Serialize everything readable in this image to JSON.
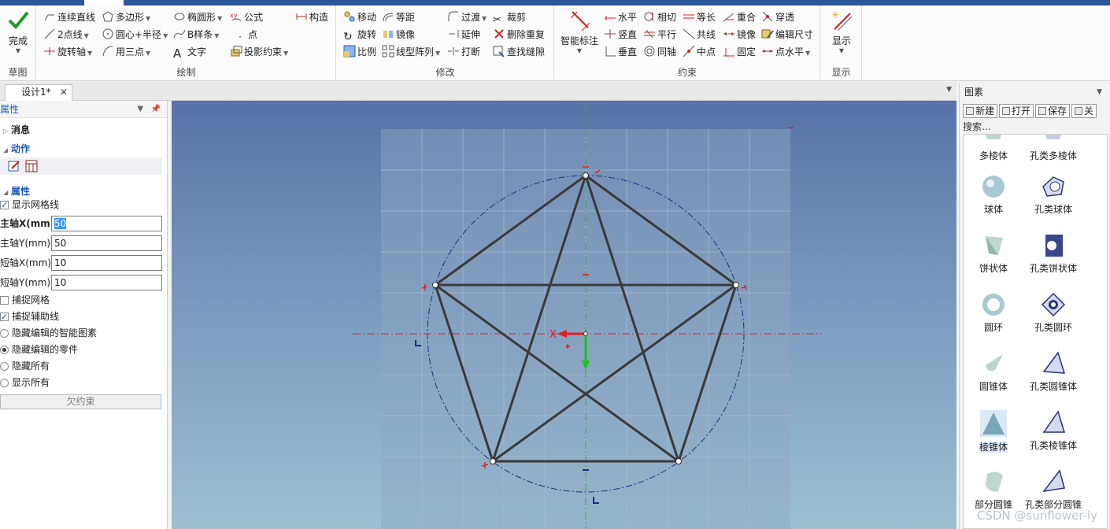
{
  "ribbon": {
    "groups": [
      {
        "label": "草图"
      },
      {
        "label": "绘制"
      },
      {
        "label": "修改"
      },
      {
        "label": "约束"
      },
      {
        "label": "显示"
      }
    ],
    "sketch": {
      "finish": "完成"
    },
    "draw": {
      "items": [
        "连续直线",
        "多边形",
        "椭圆形",
        "公式",
        "构造",
        "2点线",
        "圆心+半径",
        "B样条",
        "点",
        "旋转轴",
        "用三点",
        "文字",
        "投影约束"
      ]
    },
    "modify": {
      "items": [
        "移动",
        "等距",
        "过渡",
        "裁剪",
        "旋转",
        "镜像",
        "延伸",
        "删除重复",
        "比例",
        "线型阵列",
        "打断",
        "查找缝隙"
      ]
    },
    "constrain": {
      "smart": "智能标注",
      "items": [
        "水平",
        "相切",
        "等长",
        "重合",
        "穿透",
        "竖直",
        "平行",
        "共线",
        "镜像",
        "编辑尺寸",
        "垂直",
        "同轴",
        "中点",
        "固定",
        "点水平"
      ]
    },
    "display": {
      "label": "显示"
    }
  },
  "tabs": {
    "document": "设计1*",
    "close": "✕"
  },
  "properties": {
    "header": "属性",
    "sections": {
      "message": "消息",
      "action": "动作",
      "attributes": "属性"
    },
    "show_grid": {
      "label": "显示网格线",
      "checked": true
    },
    "fields": [
      {
        "label": "主轴X(mm)",
        "value": "50"
      },
      {
        "label": "主轴Y(mm)",
        "value": "50"
      },
      {
        "label": "短轴X(mm)",
        "value": "10"
      },
      {
        "label": "短轴Y(mm)",
        "value": "10"
      }
    ],
    "snap_grid": {
      "label": "捕捉网格",
      "checked": false
    },
    "snap_guides": {
      "label": "捕捉辅助线",
      "checked": true
    },
    "radios": [
      {
        "label": "隐藏编辑的智能图素",
        "selected": false
      },
      {
        "label": "隐藏编辑的零件",
        "selected": true
      },
      {
        "label": "隐藏所有",
        "selected": false
      },
      {
        "label": "显示所有",
        "selected": false
      }
    ],
    "status_button": "欠约束"
  },
  "canvas": {
    "axis_label": "X",
    "colors": {
      "axis_x": "#e02020",
      "axis_y": "#20c020",
      "sketch_line": "#3a3a3a",
      "circle": "#1a2f80",
      "bg_top": "#5872a8",
      "bg_bottom": "#9cc0d0"
    },
    "sketch": {
      "shape": "pentagon with inscribed pentagram",
      "circle_radius_mm": 50,
      "vertex_count": 5
    }
  },
  "catalog": {
    "header": "图素",
    "toolbar": {
      "new": "新建",
      "open": "打开",
      "save": "保存",
      "close": "关"
    },
    "search_placeholder": "搜索...",
    "items": [
      {
        "label": "多棱体",
        "icon": "prism-icon"
      },
      {
        "label": "孔类多棱体",
        "icon": "hole-prism-icon"
      },
      {
        "label": "球体",
        "icon": "sphere-icon"
      },
      {
        "label": "孔类球体",
        "icon": "hole-sphere-icon"
      },
      {
        "label": "饼状体",
        "icon": "pie-icon"
      },
      {
        "label": "孔类饼状体",
        "icon": "hole-pie-icon"
      },
      {
        "label": "圆环",
        "icon": "torus-icon"
      },
      {
        "label": "孔类圆环",
        "icon": "hole-torus-icon"
      },
      {
        "label": "圆锥体",
        "icon": "cone-icon"
      },
      {
        "label": "孔类圆锥体",
        "icon": "hole-cone-icon"
      },
      {
        "label": "棱锥体",
        "icon": "pyramid-icon"
      },
      {
        "label": "孔类棱锥体",
        "icon": "hole-pyramid-icon"
      },
      {
        "label": "部分圆锥",
        "icon": "partial-cone-icon"
      },
      {
        "label": "孔类部分圆锥",
        "icon": "hole-partial-cone-icon"
      }
    ]
  },
  "watermark": "CSDN @sunflower-ly"
}
